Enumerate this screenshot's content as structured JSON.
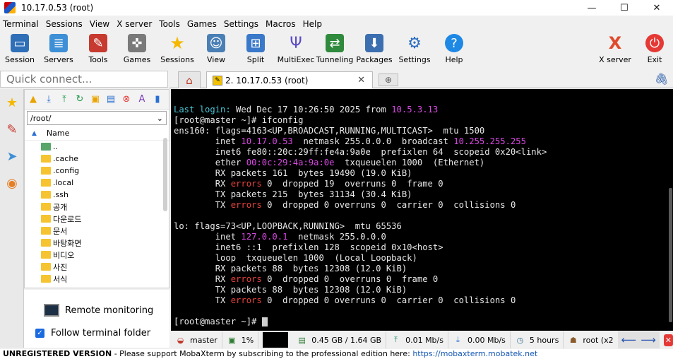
{
  "window": {
    "title": "10.17.0.53 (root)",
    "minimize": "—",
    "maximize": "☐",
    "close": "✕"
  },
  "menu": [
    "Terminal",
    "Sessions",
    "View",
    "X server",
    "Tools",
    "Games",
    "Settings",
    "Macros",
    "Help"
  ],
  "toolbar": [
    {
      "label": "Session",
      "icon": "monitor-icon",
      "color": "#2f6fb7"
    },
    {
      "label": "Servers",
      "icon": "servers-icon",
      "color": "#3d8fd6"
    },
    {
      "label": "Tools",
      "icon": "tools-icon",
      "color": "#c73a2f"
    },
    {
      "label": "Games",
      "icon": "gamepad-icon",
      "color": "#7a7a7a"
    },
    {
      "label": "Sessions",
      "icon": "star-icon",
      "color": "#f5b800"
    },
    {
      "label": "View",
      "icon": "user-icon",
      "color": "#4a7fb5"
    },
    {
      "label": "Split",
      "icon": "split-icon",
      "color": "#3a78c9"
    },
    {
      "label": "MultiExec",
      "icon": "fork-icon",
      "color": "#5b4bc4"
    },
    {
      "label": "Tunneling",
      "icon": "tunnel-icon",
      "color": "#2f8a3d"
    },
    {
      "label": "Packages",
      "icon": "package-icon",
      "color": "#3c6fb0"
    },
    {
      "label": "Settings",
      "icon": "gears-icon",
      "color": "#2b6cc2"
    },
    {
      "label": "Help",
      "icon": "help-icon",
      "color": "#1e88e5"
    },
    {
      "label": "X server",
      "icon": "xserver-icon",
      "color": "#e04b2c"
    },
    {
      "label": "Exit",
      "icon": "power-icon",
      "color": "#e53935"
    }
  ],
  "quick_connect": {
    "placeholder": "Quick connect..."
  },
  "tabs": {
    "session_label": "2. 10.17.0.53 (root)",
    "close": "✕",
    "new": "⊕"
  },
  "file_panel": {
    "path": "/root/",
    "column": "Name",
    "items": [
      {
        "name": "..",
        "kind": "parent"
      },
      {
        "name": ".cache",
        "kind": "folder"
      },
      {
        "name": ".config",
        "kind": "folder"
      },
      {
        "name": ".local",
        "kind": "folder"
      },
      {
        "name": ".ssh",
        "kind": "folder"
      },
      {
        "name": "공개",
        "kind": "folder"
      },
      {
        "name": "다운로드",
        "kind": "folder"
      },
      {
        "name": "문서",
        "kind": "folder"
      },
      {
        "name": "바탕화면",
        "kind": "folder"
      },
      {
        "name": "비디오",
        "kind": "folder"
      },
      {
        "name": "사진",
        "kind": "folder"
      },
      {
        "name": "서식",
        "kind": "folder"
      }
    ]
  },
  "bottom_options": {
    "remote_monitoring": "Remote monitoring",
    "follow_terminal": "Follow terminal folder"
  },
  "terminal": {
    "last_login_label": "Last login:",
    "last_login_text": " Wed Dec 17 10:26:50 2025 from ",
    "last_login_host": "10.5.3.13",
    "prompt": "[root@master ~]# ",
    "command": "ifconfig",
    "ens_header": "ens160: flags=4163<UP,BROADCAST,RUNNING,MULTICAST>  mtu 1500",
    "ens_inet_pre": "        inet ",
    "ens_inet_ip": "10.17.0.53",
    "ens_inet_mid": "  netmask 255.0.0.0  broadcast ",
    "ens_inet_bcast": "10.255.255.255",
    "ens_inet6": "        inet6 fe80::20c:29ff:fe4a:9a0e  prefixlen 64  scopeid 0x20<link>",
    "ens_ether_pre": "        ether ",
    "ens_ether_mac": "00:0c:29:4a:9a:0e",
    "ens_ether_post": "  txqueuelen 1000  (Ethernet)",
    "ens_rx_packets": "        RX packets 161  bytes 19490 (19.0 KiB)",
    "ens_rx_err_pre": "        RX ",
    "ens_rx_err_post": " 0  dropped 19  overruns 0  frame 0",
    "ens_tx_packets": "        TX packets 215  bytes 31134 (30.4 KiB)",
    "ens_tx_err_pre": "        TX ",
    "ens_tx_err_post": " 0  dropped 0 overruns 0  carrier 0  collisions 0",
    "errors_word": "errors",
    "lo_header": "lo: flags=73<UP,LOOPBACK,RUNNING>  mtu 65536",
    "lo_inet_pre": "        inet ",
    "lo_inet_ip": "127.0.0.1",
    "lo_inet_post": "  netmask 255.0.0.0",
    "lo_inet6": "        inet6 ::1  prefixlen 128  scopeid 0x10<host>",
    "lo_loop": "        loop  txqueuelen 1000  (Local Loopback)",
    "lo_rx_packets": "        RX packets 88  bytes 12308 (12.0 KiB)",
    "lo_rx_err_post": " 0  dropped 0  overruns 0  frame 0",
    "lo_tx_packets": "        TX packets 88  bytes 12308 (12.0 KiB)",
    "lo_tx_err_post": " 0  dropped 0 overruns 0  carrier 0  collisions 0"
  },
  "status": {
    "host": "master",
    "cpu": "1%",
    "memory": "0.45 GB / 1.64 GB",
    "upload": "0.01 Mb/s",
    "download": "0.00 Mb/s",
    "uptime": "5 hours",
    "user": "root (x2"
  },
  "footer": {
    "unregistered": "UNREGISTERED VERSION",
    "message": "  -  Please support MobaXterm by subscribing to the professional edition here:  ",
    "link": "https://mobaxterm.mobatek.net"
  }
}
